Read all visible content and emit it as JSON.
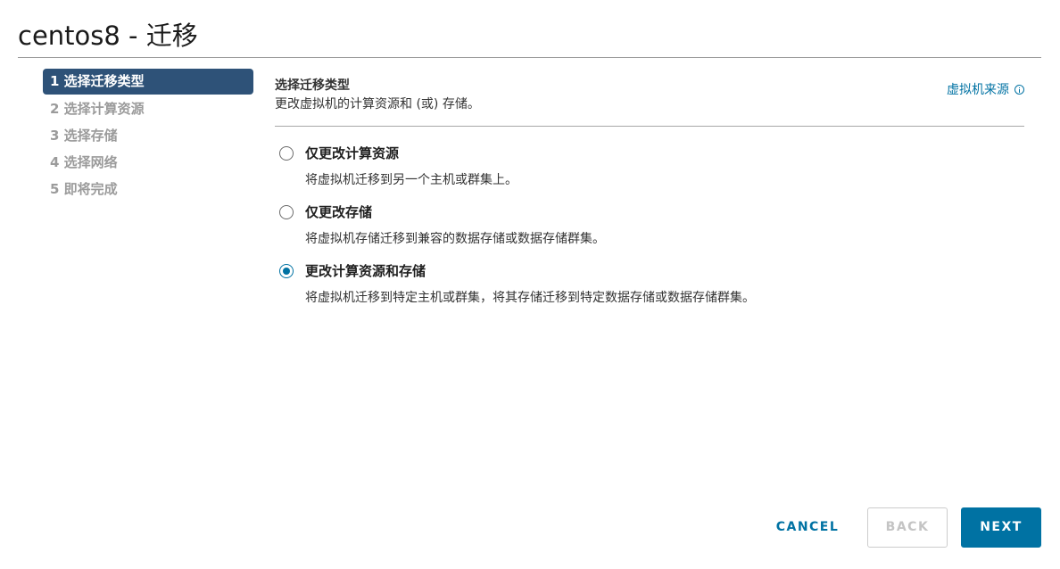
{
  "header": {
    "title": "centos8 - 迁移"
  },
  "steps": [
    {
      "label": "1 选择迁移类型",
      "active": true
    },
    {
      "label": "2 选择计算资源",
      "active": false
    },
    {
      "label": "3 选择存储",
      "active": false
    },
    {
      "label": "4 选择网络",
      "active": false
    },
    {
      "label": "5 即将完成",
      "active": false
    }
  ],
  "content": {
    "title": "选择迁移类型",
    "subtitle": "更改虚拟机的计算资源和 (或) 存储。",
    "vm_origin_link": "虚拟机来源",
    "vm_origin_icon": "info-icon"
  },
  "options": [
    {
      "label": "仅更改计算资源",
      "description": "将虚拟机迁移到另一个主机或群集上。",
      "selected": false
    },
    {
      "label": "仅更改存储",
      "description": "将虚拟机存储迁移到兼容的数据存储或数据存储群集。",
      "selected": false
    },
    {
      "label": "更改计算资源和存储",
      "description": "将虚拟机迁移到特定主机或群集，将其存储迁移到特定数据存储或数据存储群集。",
      "selected": true
    }
  ],
  "footer": {
    "cancel_label": "CANCEL",
    "back_label": "BACK",
    "next_label": "NEXT"
  },
  "colors": {
    "accent": "#0072a3",
    "active_step_bg": "#2e5278",
    "disabled_text": "#c4c4c4"
  }
}
